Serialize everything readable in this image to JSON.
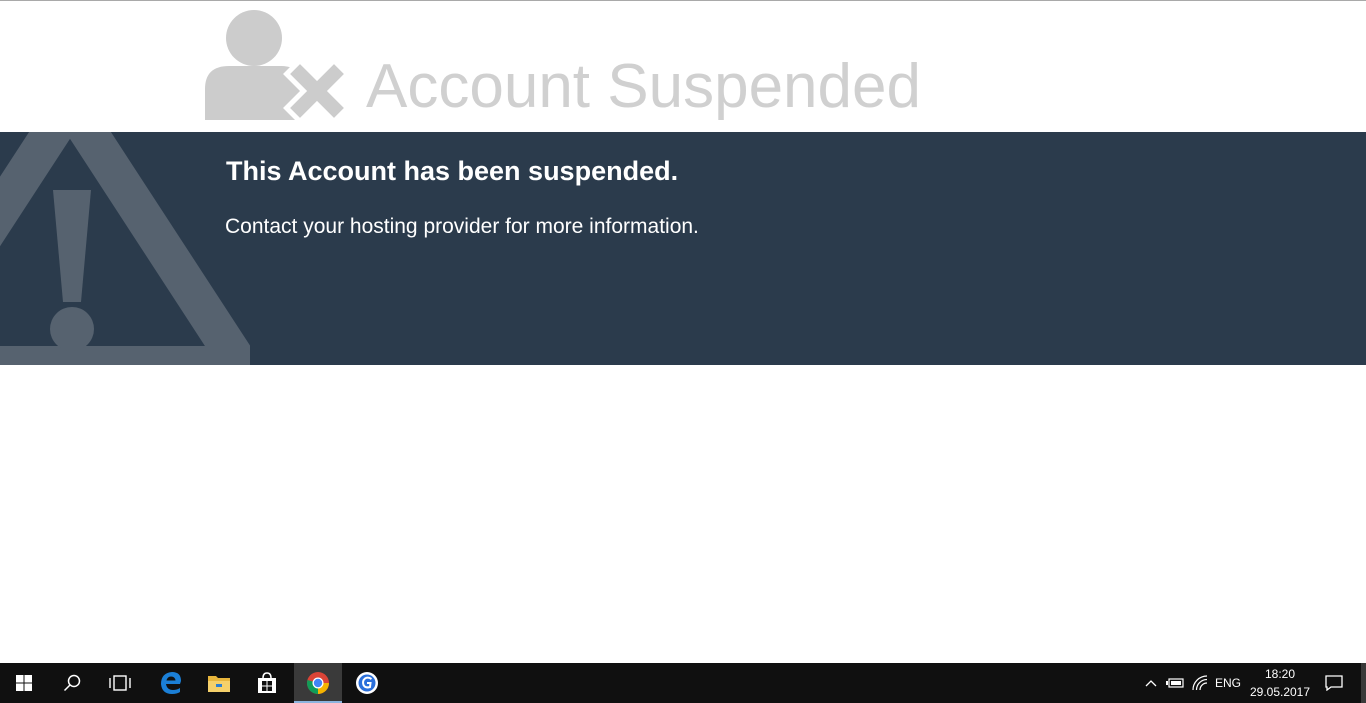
{
  "header": {
    "title": "Account Suspended",
    "icon": "user-x-icon"
  },
  "banner": {
    "heading": "This Account has been suspended.",
    "message": "Contact your hosting provider for more information.",
    "icon": "warning-icon"
  },
  "taskbar": {
    "apps": [
      "start-icon",
      "search-icon",
      "task-view-icon",
      "edge-icon",
      "file-explorer-icon",
      "store-icon",
      "chrome-icon",
      "app-icon"
    ],
    "active_app": "chrome-icon",
    "language": "ENG",
    "time": "18:20",
    "date": "29.05.2017"
  },
  "colors": {
    "banner_bg": "#2b3b4c",
    "header_text": "#d0d0d0",
    "warning_fill": "#56626f",
    "taskbar_bg": "#101010"
  }
}
